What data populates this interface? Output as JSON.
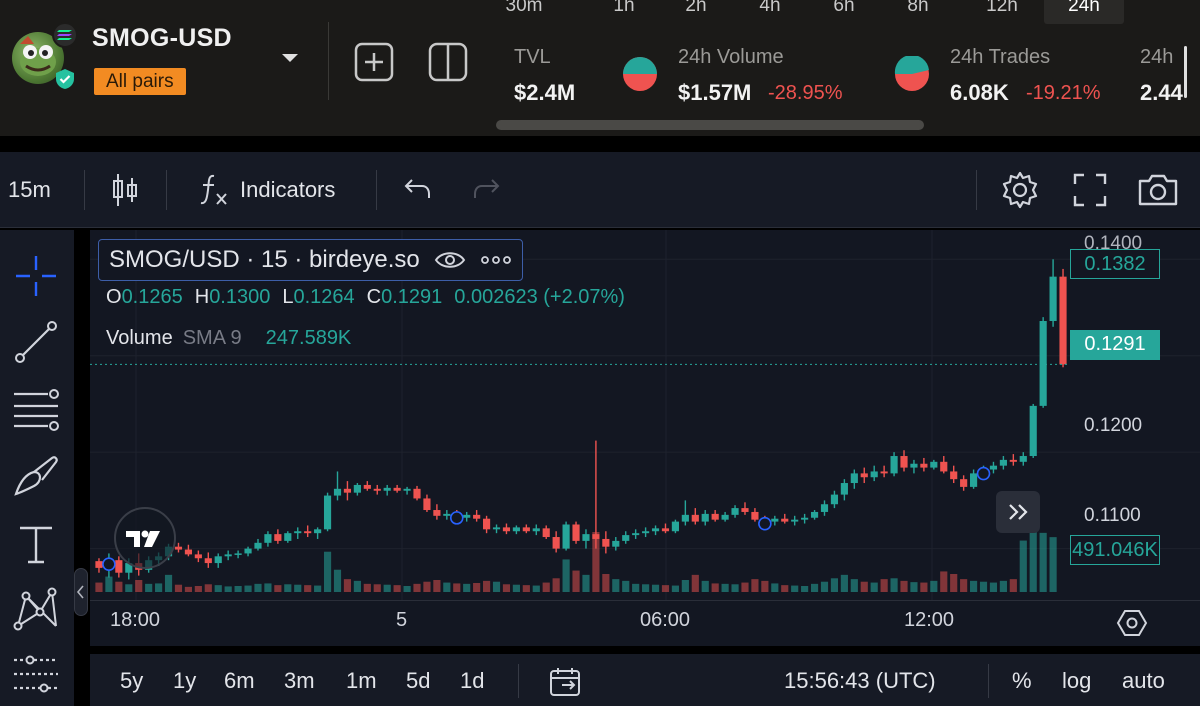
{
  "pair": {
    "name": "SMOG-USD",
    "all_pairs_label": "All pairs"
  },
  "timeframes": [
    {
      "label": "30m",
      "active": false
    },
    {
      "label": "1h",
      "active": false
    },
    {
      "label": "2h",
      "active": false
    },
    {
      "label": "4h",
      "active": false
    },
    {
      "label": "6h",
      "active": false
    },
    {
      "label": "8h",
      "active": false
    },
    {
      "label": "12h",
      "active": false
    },
    {
      "label": "24h",
      "active": true
    }
  ],
  "stats": {
    "tvl": {
      "label": "TVL",
      "value": "$2.4M"
    },
    "volume": {
      "label": "24h Volume",
      "value": "$1.57M",
      "change": "-28.95%"
    },
    "trades": {
      "label": "24h Trades",
      "value": "6.08K",
      "change": "-19.21%"
    },
    "extra": {
      "label": "24h",
      "value": "2.44"
    }
  },
  "toolbar": {
    "interval": "15m",
    "indicators_label": "Indicators"
  },
  "legend": {
    "symbol": "SMOG/USD · 15 · birdeye.so",
    "ohlc": {
      "o_label": "O",
      "o": "0.1265",
      "h_label": "H",
      "h": "0.1300",
      "l_label": "L",
      "l": "0.1264",
      "c_label": "C",
      "c": "0.1291",
      "change": "0.002623 (+2.07%)"
    },
    "volume_label": "Volume",
    "volume_indicator": "SMA 9",
    "volume_value": "247.589K"
  },
  "price_axis": {
    "top_label": "0.1400",
    "tags": {
      "high": "0.1382",
      "current": "0.1291",
      "volume": "491.046K"
    },
    "labels": [
      "0.1200",
      "0.1100"
    ]
  },
  "time_axis": [
    "18:00",
    "5",
    "06:00",
    "12:00"
  ],
  "bottom": {
    "ranges": [
      "5y",
      "1y",
      "6m",
      "3m",
      "1m",
      "5d",
      "1d"
    ],
    "clock": "15:56:43 (UTC)",
    "percent": "%",
    "log": "log",
    "auto": "auto"
  },
  "colors": {
    "up": "#26a69a",
    "down": "#ef5350",
    "accent_orange": "#f28b22",
    "background": "#131722"
  },
  "chart_data": {
    "type": "candlestick",
    "interval": "15m",
    "ylim": [
      0.1055,
      0.142
    ],
    "ohlc": [
      [
        0.1087,
        0.109,
        0.1075,
        0.108
      ],
      [
        0.108,
        0.1095,
        0.107,
        0.1088
      ],
      [
        0.1088,
        0.1092,
        0.107,
        0.1075
      ],
      [
        0.1075,
        0.109,
        0.1068,
        0.1085
      ],
      [
        0.1085,
        0.1095,
        0.1072,
        0.1078
      ],
      [
        0.1078,
        0.1092,
        0.1075,
        0.1088
      ],
      [
        0.1088,
        0.1096,
        0.1082,
        0.1092
      ],
      [
        0.1092,
        0.1105,
        0.1088,
        0.1102
      ],
      [
        0.1102,
        0.1106,
        0.1096,
        0.1099
      ],
      [
        0.1099,
        0.1104,
        0.1092,
        0.1094
      ],
      [
        0.1094,
        0.1098,
        0.1086,
        0.109
      ],
      [
        0.109,
        0.1096,
        0.108,
        0.1085
      ],
      [
        0.1085,
        0.1095,
        0.108,
        0.1092
      ],
      [
        0.1092,
        0.1098,
        0.1088,
        0.1094
      ],
      [
        0.1094,
        0.1098,
        0.109,
        0.1095
      ],
      [
        0.1095,
        0.1102,
        0.1092,
        0.11
      ],
      [
        0.11,
        0.111,
        0.1098,
        0.1106
      ],
      [
        0.1106,
        0.1118,
        0.1102,
        0.1115
      ],
      [
        0.1115,
        0.112,
        0.1105,
        0.1108
      ],
      [
        0.1108,
        0.1118,
        0.1106,
        0.1116
      ],
      [
        0.1116,
        0.1122,
        0.111,
        0.1118
      ],
      [
        0.1118,
        0.1124,
        0.1112,
        0.1116
      ],
      [
        0.1116,
        0.1122,
        0.111,
        0.112
      ],
      [
        0.112,
        0.1158,
        0.1118,
        0.1155
      ],
      [
        0.1155,
        0.118,
        0.115,
        0.1162
      ],
      [
        0.1162,
        0.117,
        0.115,
        0.1158
      ],
      [
        0.1158,
        0.1168,
        0.1155,
        0.1166
      ],
      [
        0.1166,
        0.117,
        0.116,
        0.1162
      ],
      [
        0.1162,
        0.1166,
        0.1156,
        0.116
      ],
      [
        0.116,
        0.1166,
        0.1155,
        0.1163
      ],
      [
        0.1163,
        0.1166,
        0.1158,
        0.116
      ],
      [
        0.116,
        0.1164,
        0.1156,
        0.1162
      ],
      [
        0.1162,
        0.1165,
        0.115,
        0.1152
      ],
      [
        0.1152,
        0.1156,
        0.1138,
        0.114
      ],
      [
        0.114,
        0.1146,
        0.113,
        0.1134
      ],
      [
        0.1134,
        0.114,
        0.113,
        0.1136
      ],
      [
        0.1136,
        0.114,
        0.1128,
        0.1132
      ],
      [
        0.1132,
        0.1138,
        0.1128,
        0.1135
      ],
      [
        0.1135,
        0.114,
        0.1128,
        0.1131
      ],
      [
        0.1131,
        0.1134,
        0.1116,
        0.112
      ],
      [
        0.112,
        0.1125,
        0.1116,
        0.1122
      ],
      [
        0.1122,
        0.1126,
        0.1115,
        0.1118
      ],
      [
        0.1118,
        0.1124,
        0.1115,
        0.1122
      ],
      [
        0.1122,
        0.1125,
        0.1116,
        0.1118
      ],
      [
        0.1118,
        0.1125,
        0.1114,
        0.1121
      ],
      [
        0.1121,
        0.1124,
        0.111,
        0.1112
      ],
      [
        0.1112,
        0.1118,
        0.1096,
        0.11
      ],
      [
        0.11,
        0.1128,
        0.1098,
        0.1125
      ],
      [
        0.1125,
        0.1128,
        0.1105,
        0.1108
      ],
      [
        0.1108,
        0.112,
        0.11,
        0.1115
      ],
      [
        0.1115,
        0.1212,
        0.11,
        0.111
      ],
      [
        0.111,
        0.1118,
        0.1095,
        0.1102
      ],
      [
        0.1102,
        0.1112,
        0.1098,
        0.1108
      ],
      [
        0.1108,
        0.1118,
        0.1105,
        0.1114
      ],
      [
        0.1114,
        0.112,
        0.111,
        0.1116
      ],
      [
        0.1116,
        0.1122,
        0.1112,
        0.1118
      ],
      [
        0.1118,
        0.1124,
        0.1114,
        0.1121
      ],
      [
        0.1121,
        0.1126,
        0.1116,
        0.1118
      ],
      [
        0.1118,
        0.113,
        0.1116,
        0.1128
      ],
      [
        0.1128,
        0.115,
        0.1124,
        0.1135
      ],
      [
        0.1135,
        0.1142,
        0.1125,
        0.1128
      ],
      [
        0.1128,
        0.114,
        0.1124,
        0.1136
      ],
      [
        0.1136,
        0.114,
        0.1128,
        0.113
      ],
      [
        0.113,
        0.1138,
        0.1128,
        0.1135
      ],
      [
        0.1135,
        0.1145,
        0.1132,
        0.1142
      ],
      [
        0.1142,
        0.1148,
        0.1135,
        0.1138
      ],
      [
        0.1138,
        0.1142,
        0.1128,
        0.113
      ],
      [
        0.113,
        0.1134,
        0.1124,
        0.1128
      ],
      [
        0.1128,
        0.1134,
        0.1124,
        0.1131
      ],
      [
        0.1131,
        0.1136,
        0.1126,
        0.1128
      ],
      [
        0.1128,
        0.1134,
        0.1124,
        0.113
      ],
      [
        0.113,
        0.1136,
        0.1126,
        0.1132
      ],
      [
        0.1132,
        0.114,
        0.113,
        0.1138
      ],
      [
        0.1138,
        0.115,
        0.1134,
        0.1146
      ],
      [
        0.1146,
        0.116,
        0.1142,
        0.1156
      ],
      [
        0.1156,
        0.1172,
        0.115,
        0.1168
      ],
      [
        0.1168,
        0.1182,
        0.1162,
        0.1178
      ],
      [
        0.1178,
        0.1184,
        0.1168,
        0.1174
      ],
      [
        0.1174,
        0.1186,
        0.117,
        0.118
      ],
      [
        0.118,
        0.1186,
        0.1174,
        0.1178
      ],
      [
        0.1178,
        0.12,
        0.1175,
        0.1196
      ],
      [
        0.1196,
        0.1202,
        0.118,
        0.1184
      ],
      [
        0.1184,
        0.1192,
        0.1178,
        0.1188
      ],
      [
        0.1188,
        0.1194,
        0.118,
        0.1184
      ],
      [
        0.1184,
        0.1192,
        0.1182,
        0.119
      ],
      [
        0.119,
        0.1196,
        0.1178,
        0.118
      ],
      [
        0.118,
        0.1186,
        0.1168,
        0.1172
      ],
      [
        0.1172,
        0.1176,
        0.116,
        0.1164
      ],
      [
        0.1164,
        0.1182,
        0.1162,
        0.1178
      ],
      [
        0.1178,
        0.1186,
        0.1172,
        0.1182
      ],
      [
        0.1182,
        0.119,
        0.1178,
        0.1186
      ],
      [
        0.1186,
        0.1196,
        0.1182,
        0.1192
      ],
      [
        0.1192,
        0.1198,
        0.1186,
        0.119
      ],
      [
        0.119,
        0.12,
        0.1186,
        0.1196
      ],
      [
        0.1196,
        0.125,
        0.1194,
        0.1248
      ],
      [
        0.1248,
        0.134,
        0.1246,
        0.1336
      ],
      [
        0.1336,
        0.14,
        0.133,
        0.1382
      ],
      [
        0.1382,
        0.139,
        0.1288,
        0.1291
      ]
    ],
    "volume_max": 700,
    "volume": [
      110,
      180,
      120,
      90,
      140,
      95,
      100,
      200,
      85,
      60,
      70,
      90,
      80,
      65,
      70,
      75,
      95,
      100,
      80,
      90,
      85,
      80,
      75,
      470,
      260,
      150,
      130,
      95,
      90,
      85,
      80,
      70,
      95,
      120,
      140,
      110,
      100,
      95,
      105,
      130,
      120,
      90,
      85,
      80,
      75,
      110,
      160,
      380,
      250,
      200,
      900,
      210,
      150,
      130,
      95,
      90,
      85,
      80,
      75,
      140,
      200,
      130,
      100,
      95,
      90,
      110,
      150,
      130,
      100,
      80,
      75,
      70,
      95,
      120,
      160,
      200,
      150,
      120,
      110,
      150,
      160,
      130,
      115,
      110,
      130,
      240,
      210,
      150,
      130,
      120,
      110,
      130,
      150,
      600,
      700,
      690,
      640
    ],
    "markers": [
      1,
      36,
      67,
      89
    ]
  }
}
